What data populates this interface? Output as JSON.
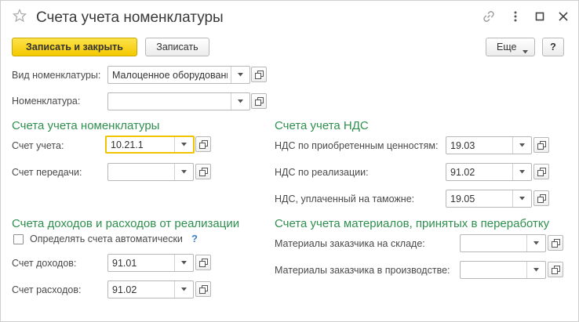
{
  "window": {
    "title": "Счета учета номенклатуры",
    "icons": [
      "star-icon",
      "link-icon",
      "more-vert-icon",
      "maximize-icon",
      "close-icon"
    ]
  },
  "toolbar": {
    "save_close_label": "Записать и закрыть",
    "save_label": "Записать",
    "more_label": "Еще",
    "help_label": "?"
  },
  "top_fields": {
    "kind_label": "Вид номенклатуры:",
    "kind_value": "Малоценное оборудование",
    "item_label": "Номенклатура:",
    "item_value": ""
  },
  "item_accounts": {
    "heading": "Счета учета номенклатуры",
    "account_label": "Счет учета:",
    "account_value": "10.21.1",
    "transfer_label": "Счет передачи:",
    "transfer_value": ""
  },
  "vat_accounts": {
    "heading": "Счета учета НДС",
    "purchased_label": "НДС по приобретенным ценностям:",
    "purchased_value": "19.03",
    "sales_label": "НДС по реализации:",
    "sales_value": "91.02",
    "customs_label": "НДС, уплаченный на таможне:",
    "customs_value": "19.05"
  },
  "income_accounts": {
    "heading": "Счета доходов и расходов от реализации",
    "auto_label": "Определять счета автоматически",
    "auto_checked": false,
    "help": "?",
    "income_label": "Счет доходов:",
    "income_value": "91.01",
    "expense_label": "Счет расходов:",
    "expense_value": "91.02"
  },
  "materials_accounts": {
    "heading": "Счета учета материалов, принятых в переработку",
    "warehouse_label": "Материалы заказчика на складе:",
    "warehouse_value": "",
    "production_label": "Материалы заказчика в производстве:",
    "production_value": ""
  },
  "colors": {
    "section_heading": "#2f8f4e",
    "primary_button": "#f4c900",
    "focus_border": "#f0c400",
    "help_link": "#3d7fc4"
  }
}
